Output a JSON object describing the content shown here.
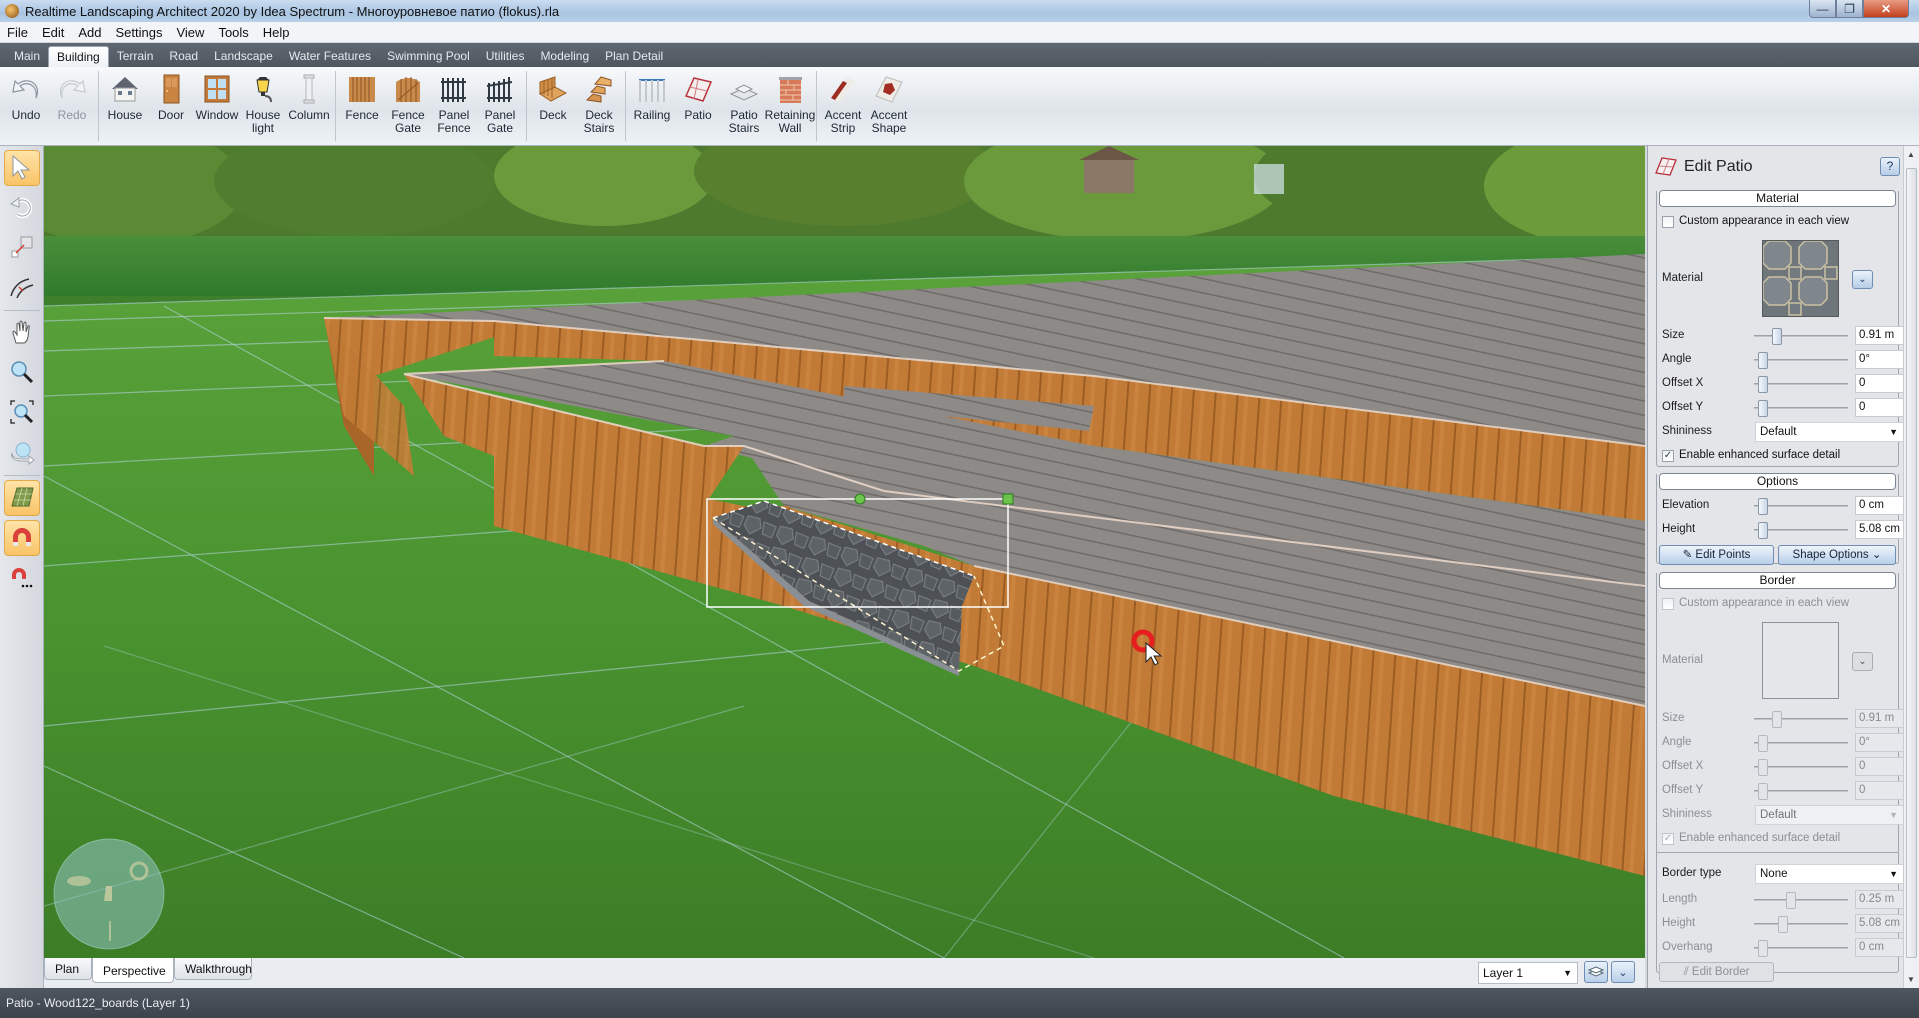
{
  "window": {
    "title": "Realtime Landscaping Architect 2020 by Idea Spectrum - Многоуровневое патио (flokus).rla",
    "minimize": "—",
    "maximize": "❐",
    "close": "✕"
  },
  "menu": [
    "File",
    "Edit",
    "Add",
    "Settings",
    "View",
    "Tools",
    "Help"
  ],
  "ribbon_tabs": [
    {
      "label": "Main",
      "active": false
    },
    {
      "label": "Building",
      "active": true
    },
    {
      "label": "Terrain",
      "active": false
    },
    {
      "label": "Road",
      "active": false
    },
    {
      "label": "Landscape",
      "active": false
    },
    {
      "label": "Water Features",
      "active": false
    },
    {
      "label": "Swimming Pool",
      "active": false
    },
    {
      "label": "Utilities",
      "active": false
    },
    {
      "label": "Modeling",
      "active": false
    },
    {
      "label": "Plan Detail",
      "active": false
    }
  ],
  "ribbon_buttons": [
    {
      "label": "Undo",
      "icon": "undo-icon",
      "enabled": true
    },
    {
      "label": "Redo",
      "icon": "redo-icon",
      "enabled": false
    },
    {
      "label": "House",
      "icon": "house-icon",
      "enabled": true
    },
    {
      "label": "Door",
      "icon": "door-icon",
      "enabled": true
    },
    {
      "label": "Window",
      "icon": "window-icon",
      "enabled": true
    },
    {
      "label": "House\nlight",
      "icon": "house-light-icon",
      "enabled": true
    },
    {
      "label": "Column",
      "icon": "column-icon",
      "enabled": true
    },
    {
      "label": "Fence",
      "icon": "fence-icon",
      "enabled": true
    },
    {
      "label": "Fence\nGate",
      "icon": "fence-gate-icon",
      "enabled": true
    },
    {
      "label": "Panel\nFence",
      "icon": "panel-fence-icon",
      "enabled": true
    },
    {
      "label": "Panel\nGate",
      "icon": "panel-gate-icon",
      "enabled": true
    },
    {
      "label": "Deck",
      "icon": "deck-icon",
      "enabled": true
    },
    {
      "label": "Deck\nStairs",
      "icon": "deck-stairs-icon",
      "enabled": true
    },
    {
      "label": "Railing",
      "icon": "railing-icon",
      "enabled": true
    },
    {
      "label": "Patio",
      "icon": "patio-icon",
      "enabled": true
    },
    {
      "label": "Patio\nStairs",
      "icon": "patio-stairs-icon",
      "enabled": true
    },
    {
      "label": "Retaining\nWall",
      "icon": "retaining-wall-icon",
      "enabled": true
    },
    {
      "label": "Accent\nStrip",
      "icon": "accent-strip-icon",
      "enabled": true
    },
    {
      "label": "Accent\nShape",
      "icon": "accent-shape-icon",
      "enabled": true
    }
  ],
  "left_tools": [
    {
      "name": "select-tool",
      "active": true
    },
    {
      "name": "rotate-tool",
      "active": false
    },
    {
      "name": "resize-tool",
      "active": false
    },
    {
      "name": "curve-tool",
      "active": false
    },
    {
      "name": "pan-tool",
      "active": false
    },
    {
      "name": "zoom-tool",
      "active": false
    },
    {
      "name": "zoom-region-tool",
      "active": false
    },
    {
      "name": "orbit-tool",
      "active": false
    },
    {
      "name": "grid-toggle",
      "active": true
    },
    {
      "name": "snap-toggle",
      "active": true
    },
    {
      "name": "snap-options",
      "active": false
    }
  ],
  "view_tabs": [
    {
      "label": "Plan",
      "active": false
    },
    {
      "label": "Perspective",
      "active": true
    },
    {
      "label": "Walkthrough",
      "active": false
    }
  ],
  "layer": {
    "selected": "Layer 1"
  },
  "status": "Patio - Wood122_boards (Layer 1)",
  "panel": {
    "title": "Edit Patio",
    "help": "?",
    "material": {
      "header": "Material",
      "custom_appearance": {
        "label": "Custom appearance in each view",
        "checked": false
      },
      "material_label": "Material",
      "size": {
        "label": "Size",
        "value": "0.91 m",
        "slider": 0.22
      },
      "angle": {
        "label": "Angle",
        "value": "0°",
        "slider": 0.05
      },
      "offset_x": {
        "label": "Offset X",
        "value": "0",
        "slider": 0.05
      },
      "offset_y": {
        "label": "Offset Y",
        "value": "0",
        "slider": 0.05
      },
      "shininess": {
        "label": "Shininess",
        "value": "Default"
      },
      "enhanced": {
        "label": "Enable enhanced surface detail",
        "checked": true
      }
    },
    "options": {
      "header": "Options",
      "elevation": {
        "label": "Elevation",
        "value": "0 cm",
        "slider": 0.05
      },
      "height": {
        "label": "Height",
        "value": "5.08 cm",
        "slider": 0.05
      },
      "edit_points": "Edit Points",
      "shape_options": "Shape Options"
    },
    "border": {
      "header": "Border",
      "custom_appearance": {
        "label": "Custom appearance in each view",
        "checked": false
      },
      "material_label": "Material",
      "size": {
        "label": "Size",
        "value": "0.91 m",
        "slider": 0.22
      },
      "angle": {
        "label": "Angle",
        "value": "0°",
        "slider": 0.05
      },
      "offset_x": {
        "label": "Offset X",
        "value": "0",
        "slider": 0.05
      },
      "offset_y": {
        "label": "Offset Y",
        "value": "0",
        "slider": 0.05
      },
      "shininess": {
        "label": "Shininess",
        "value": "Default"
      },
      "enhanced": {
        "label": "Enable enhanced surface detail",
        "checked": true
      },
      "border_type": {
        "label": "Border type",
        "value": "None"
      },
      "length": {
        "label": "Length",
        "value": "0.25 m",
        "slider": 0.38
      },
      "height": {
        "label": "Height",
        "value": "5.08 cm",
        "slider": 0.28
      },
      "overhang": {
        "label": "Overhang",
        "value": "0 cm",
        "slider": 0.05
      },
      "edit_border": "Edit Border"
    }
  },
  "colors": {
    "accent": "#f9c467",
    "deck_wood": "#c07a34",
    "deck_top": "#8f8c8a",
    "grass": "#3f8a2c"
  }
}
